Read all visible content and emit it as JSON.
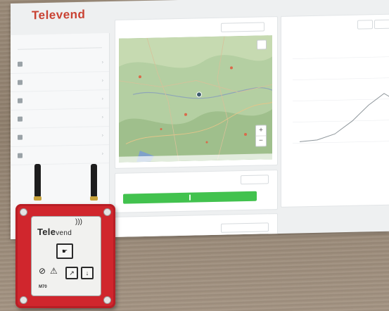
{
  "dashboard": {
    "logo_text": "Televend",
    "sidebar": {
      "search": "",
      "items": [
        {
          "label": "",
          "icon": "dashboard-icon"
        },
        {
          "label": "",
          "icon": "machines-icon"
        },
        {
          "label": "",
          "icon": "locations-icon"
        },
        {
          "label": "",
          "icon": "reports-icon"
        },
        {
          "label": "",
          "icon": "settings-icon"
        },
        {
          "label": "",
          "icon": "users-icon"
        }
      ]
    },
    "map_card": {
      "title": "",
      "zoom_in": "+",
      "zoom_out": "−"
    },
    "status_card": {
      "title": "",
      "button": ""
    },
    "chart_card": {
      "title": "",
      "footer_label": "",
      "footer_value": ""
    },
    "bottom_card": {
      "title": "",
      "button": ""
    },
    "colors": {
      "accent": "#c94233",
      "status_green": "#42c24e"
    }
  },
  "device": {
    "brand": "Tele",
    "brand_suffix": "vend",
    "model": "M70",
    "buttons": [
      {
        "name": "tap-icon"
      },
      {
        "name": "warning-icon"
      },
      {
        "name": "pump-icon"
      },
      {
        "name": "download-icon"
      }
    ],
    "colors": {
      "housing": "#d0262d",
      "face": "#f1f1ef"
    }
  }
}
